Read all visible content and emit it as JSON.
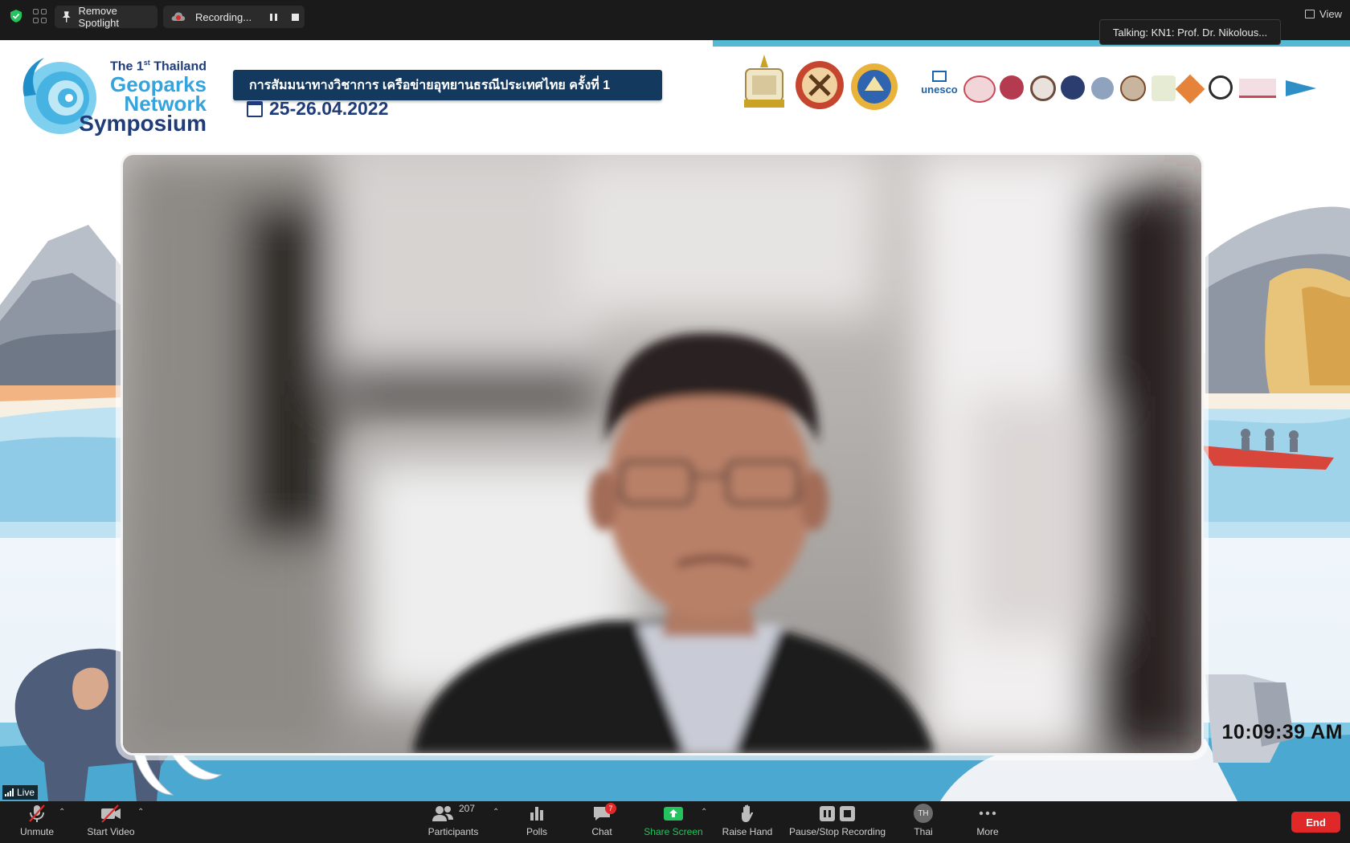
{
  "topbar": {
    "remove_spotlight_label": "Remove Spotlight",
    "recording_label": "Recording...",
    "view_label": "View",
    "talking_label": "Talking: KN1: Prof. Dr. Nikolous..."
  },
  "stage": {
    "logo": {
      "line1": "The 1",
      "line1_sup": "st",
      "line1_rest": " Thailand",
      "line2": "Geoparks",
      "line3": "Network",
      "line4": "Symposium"
    },
    "banner_text": "การสัมมนาทางวิชาการ เครือข่ายอุทยานธรณีประเทศไทย ครั้งที่ 1",
    "date_text": "25-26.04.2022",
    "unesco_text": "unesco",
    "clock": "10:09:39 AM",
    "live_label": "Live"
  },
  "toolbar": {
    "unmute_label": "Unmute",
    "start_video_label": "Start Video",
    "participants_label": "Participants",
    "participants_count": "207",
    "polls_label": "Polls",
    "chat_label": "Chat",
    "chat_badge": "7",
    "share_screen_label": "Share Screen",
    "raise_hand_label": "Raise Hand",
    "pause_stop_recording_label": "Pause/Stop Recording",
    "language_label": "Thai",
    "language_avatar": "TH",
    "more_label": "More",
    "end_label": "End"
  },
  "colors": {
    "end_red": "#e02828",
    "share_green": "#24c35e",
    "banner_navy": "#14395e",
    "brand_blue": "#35a3dc"
  }
}
